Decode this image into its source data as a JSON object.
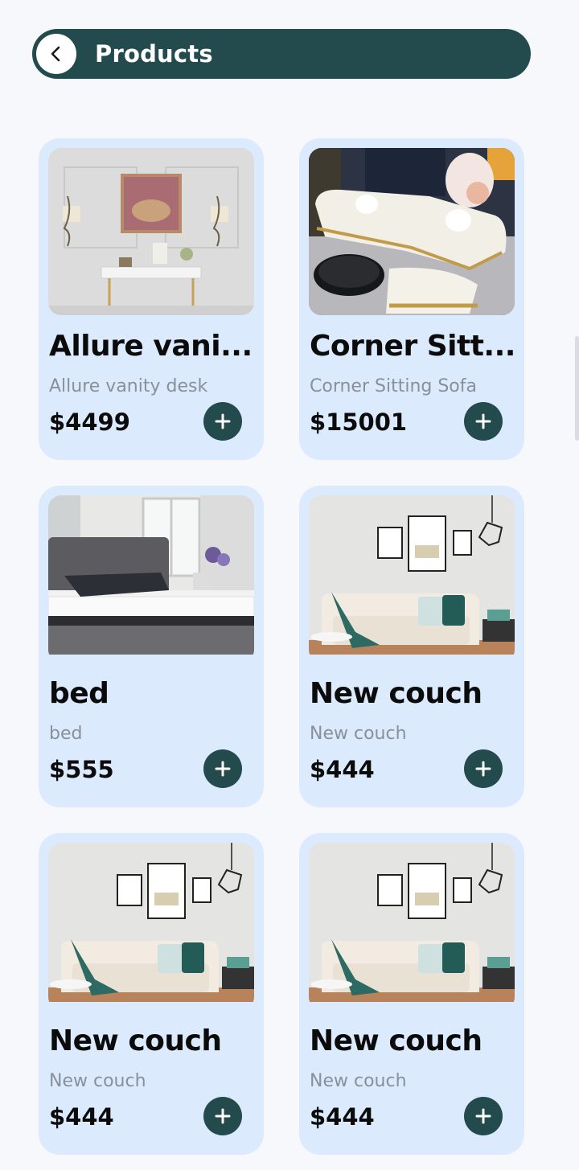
{
  "header": {
    "title": "Products",
    "back_icon": "chevron-left-icon",
    "background": "#234a4c"
  },
  "products": [
    {
      "title": "Allure vani...",
      "subtitle": "Allure vanity desk",
      "price": "$4499",
      "image": "vanity-desk-photo"
    },
    {
      "title": "Corner Sitt...",
      "subtitle": "Corner Sitting Sofa",
      "price": "$15001",
      "image": "corner-sofa-photo"
    },
    {
      "title": "bed",
      "subtitle": "bed",
      "price": "$555",
      "image": "bed-photo"
    },
    {
      "title": "New couch",
      "subtitle": "New couch",
      "price": "$444",
      "image": "couch-photo"
    },
    {
      "title": "New couch",
      "subtitle": "New couch",
      "price": "$444",
      "image": "couch-photo"
    },
    {
      "title": "New couch",
      "subtitle": "New couch",
      "price": "$444",
      "image": "couch-photo"
    }
  ],
  "colors": {
    "card_background": "#dbeafd",
    "accent": "#234a4c",
    "page_background": "#f6f8fc"
  },
  "add_icon": "plus-icon"
}
